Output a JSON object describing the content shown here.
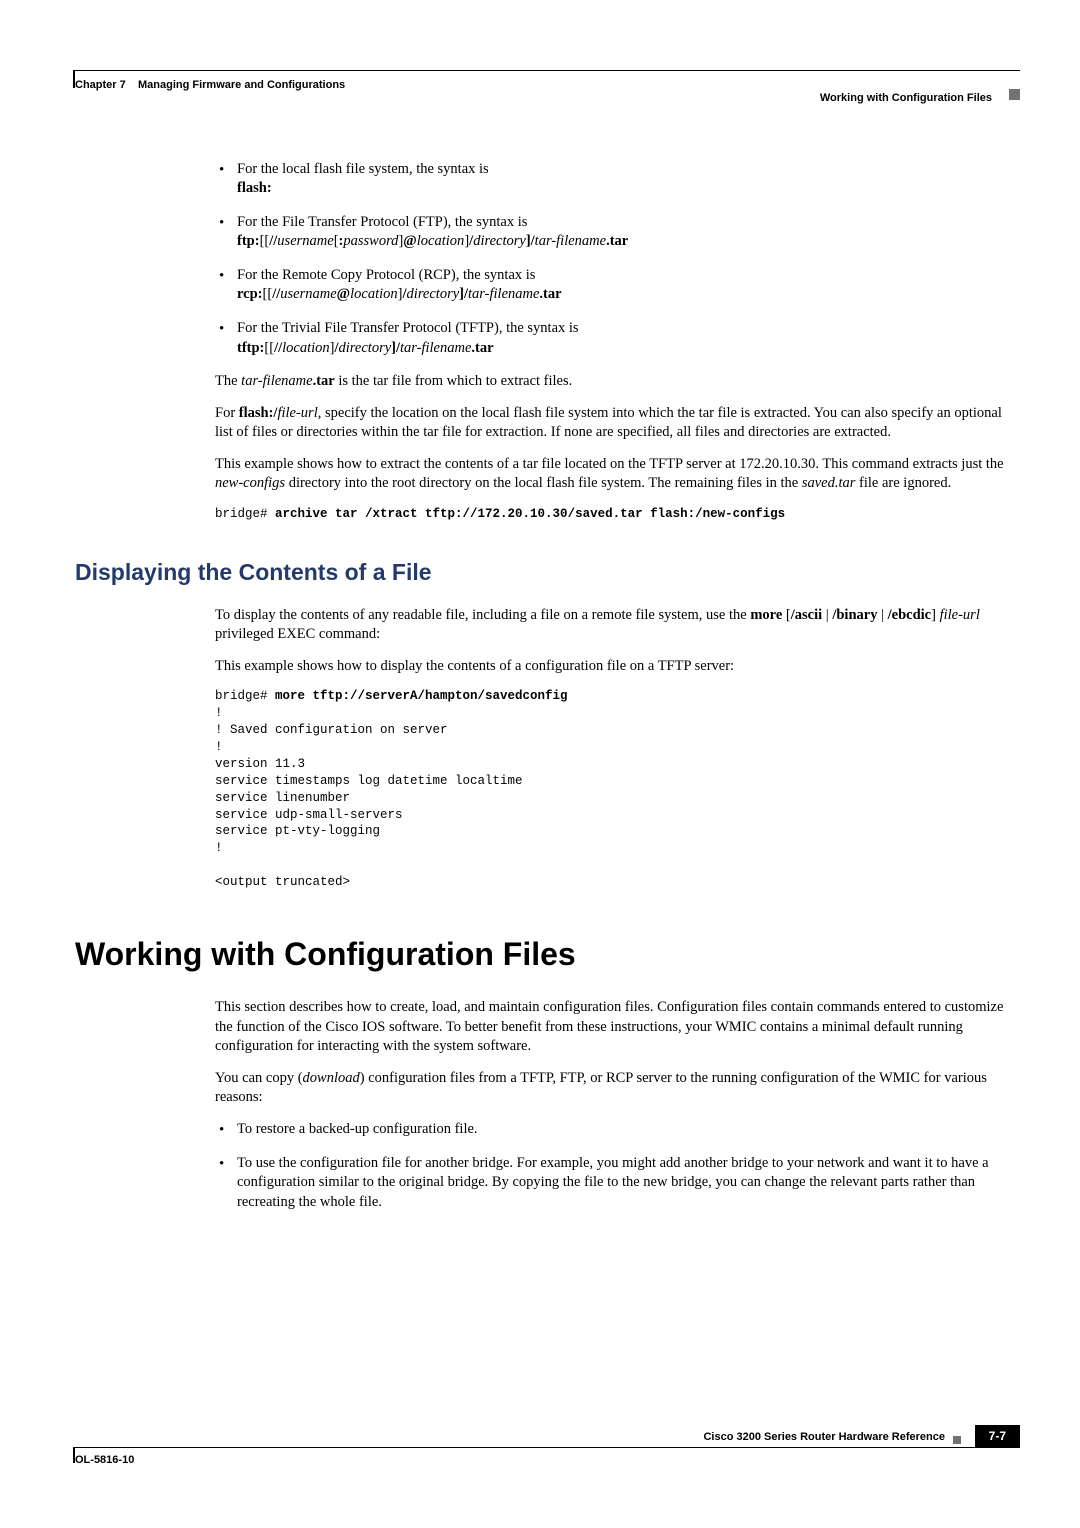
{
  "header": {
    "chapter_prefix": "Chapter 7",
    "chapter_title": "Managing Firmware and Configurations",
    "section": "Working with Configuration Files"
  },
  "bullets": {
    "b1": {
      "text": "For the local flash file system, the syntax is",
      "syntax": "flash:"
    },
    "b2": {
      "text": "For the File Transfer Protocol (FTP), the syntax is",
      "pre": "ftp:",
      "mid1": "[[",
      "sep1": "//",
      "u": "username",
      "sep2": "[",
      "colon": ":",
      "p": "password",
      "sep3": "]",
      "at": "@",
      "loc": "location",
      "sep4": "]",
      "sl1": "/",
      "dir": "directory",
      "sl2": "]/",
      "tf": "tar-filename",
      "tar": ".tar"
    },
    "b3": {
      "text": "For the Remote Copy Protocol (RCP), the syntax is",
      "pre": "rcp:",
      "mid1": "[[",
      "sep1": "//",
      "u": "username",
      "at": "@",
      "loc": "location",
      "sep4": "]",
      "sl1": "/",
      "dir": "directory",
      "sl2": "]/",
      "tf": "tar-filename",
      "tar": ".tar"
    },
    "b4": {
      "text": "For the Trivial File Transfer Protocol (TFTP), the syntax is",
      "pre": "tftp:",
      "mid1": "[[",
      "sep1": "//",
      "loc": "location",
      "sep4": "]",
      "sl1": "/",
      "dir": "directory",
      "sl2": "]/",
      "tf": "tar-filename",
      "tar": ".tar"
    }
  },
  "para": {
    "p1a": "The ",
    "p1b": "tar-filename",
    "p1c": ".tar",
    "p1d": " is the tar file from which to extract files.",
    "p2a": "For ",
    "p2b": "flash:/",
    "p2c": "file-url",
    "p2d": ", specify the location on the local flash file system into which the tar file is extracted. You can also specify an optional list of files or directories within the tar file for extraction. If none are specified, all files and directories are extracted.",
    "p3a": "This example shows how to extract the contents of a tar file located on the TFTP server at 172.20.10.30. This command extracts just the ",
    "p3b": "new-configs",
    "p3c": " directory into the root directory on the local flash file system. The remaining files in the ",
    "p3d": "saved.tar",
    "p3e": " file are ignored."
  },
  "cli1": {
    "prompt": "bridge# ",
    "cmd": "archive tar /xtract tftp://172.20.10.30/saved.tar flash:/new-configs"
  },
  "h2": "Displaying the Contents of a File",
  "disp": {
    "p1a": "To display the contents of any readable file, including a file on a remote file system, use the ",
    "p1b": "more",
    "p1c": " [",
    "p1d": "/ascii",
    "p1e": " | ",
    "p1f": "/binary",
    "p1g": " | ",
    "p1h": "/ebcdic",
    "p1i": "] ",
    "p1j": "file-url",
    "p1k": " privileged EXEC command:",
    "p2": "This example shows how to display the contents of a configuration file on a TFTP server:"
  },
  "cli2": {
    "prompt": "bridge# ",
    "cmd": "more tftp://serverA/hampton/savedconfig",
    "body": "!\n! Saved configuration on server\n!\nversion 11.3\nservice timestamps log datetime localtime\nservice linenumber\nservice udp-small-servers\nservice pt-vty-logging\n!\n\n<output truncated>"
  },
  "h1": "Working with Configuration Files",
  "wcf": {
    "p1": "This section describes how to create, load, and maintain configuration files. Configuration files contain commands entered to customize the function of the Cisco IOS software. To better benefit from these instructions, your WMIC contains a minimal default running configuration for interacting with the system software.",
    "p2a": "You can copy (",
    "p2b": "download",
    "p2c": ") configuration files from a TFTP, FTP, or RCP server to the running configuration of the WMIC for various reasons:",
    "b1": "To restore a backed-up configuration file.",
    "b2": "To use the configuration file for another bridge. For example, you might add another bridge to your network and want it to have a configuration similar to the original bridge. By copying the file to the new bridge, you can change the relevant parts rather than recreating the whole file."
  },
  "footer": {
    "title": "Cisco 3200 Series Router Hardware Reference",
    "doc": "OL-5816-10",
    "page": "7-7"
  }
}
